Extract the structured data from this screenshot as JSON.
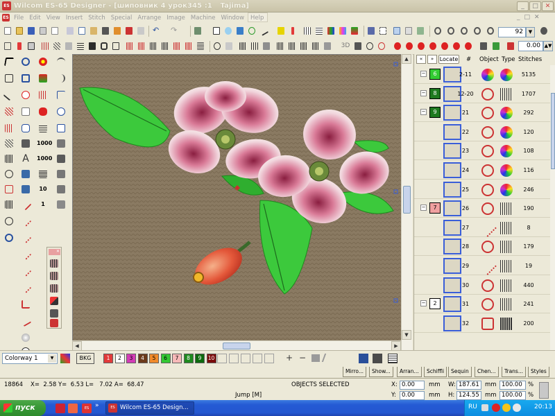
{
  "window": {
    "title": "Wilcom ES-65 Designer - [шиповник 4 урок345 :1",
    "machine": "Tajima]"
  },
  "menu": [
    "File",
    "Edit",
    "View",
    "Insert",
    "Stitch",
    "Special",
    "Arrange",
    "Image",
    "Machine",
    "Window",
    "Help"
  ],
  "toolbar": {
    "zoom_value": "92",
    "angle_value": "0.00"
  },
  "objects_panel": {
    "locate_label": "Locate",
    "columns": [
      "#",
      "Object",
      "Type",
      "Stitches"
    ],
    "rows": [
      {
        "group": "6",
        "group_color": "#33cc33",
        "num": "2-11",
        "stitches": "5135",
        "object_icon": "multicolor-icon",
        "type_icon": "multicolor-icon"
      },
      {
        "group": "8",
        "group_color": "#1f7a1f",
        "num": "12-20",
        "stitches": "1707",
        "object_icon": "complex-fill-icon",
        "type_icon": "satin-icon"
      },
      {
        "group": "9",
        "group_color": "#1f7a1f",
        "num": "21",
        "stitches": "292",
        "object_icon": "complex-fill-icon",
        "type_icon": "multicolor-icon"
      },
      {
        "group": "",
        "num": "22",
        "stitches": "120",
        "object_icon": "complex-fill-icon",
        "type_icon": "multicolor-icon"
      },
      {
        "group": "",
        "num": "23",
        "stitches": "108",
        "object_icon": "complex-fill-icon",
        "type_icon": "multicolor-icon"
      },
      {
        "group": "",
        "num": "24",
        "stitches": "116",
        "object_icon": "complex-fill-icon",
        "type_icon": "multicolor-icon"
      },
      {
        "group": "",
        "num": "25",
        "stitches": "246",
        "object_icon": "complex-fill-icon",
        "type_icon": "multicolor-icon"
      },
      {
        "group": "7",
        "group_color": "#f0a0a0",
        "num": "26",
        "stitches": "190",
        "object_icon": "complex-fill-icon",
        "type_icon": "satin-icon"
      },
      {
        "group": "",
        "num": "27",
        "stitches": "8",
        "object_icon": "run-icon",
        "type_icon": "satin-icon"
      },
      {
        "group": "",
        "num": "28",
        "stitches": "179",
        "object_icon": "complex-fill-icon",
        "type_icon": "satin-icon"
      },
      {
        "group": "",
        "num": "29",
        "stitches": "19",
        "object_icon": "run-icon",
        "type_icon": "satin-icon"
      },
      {
        "group": "",
        "num": "30",
        "stitches": "440",
        "object_icon": "complex-fill-icon",
        "type_icon": "satin-icon"
      },
      {
        "group": "2",
        "group_color": "#ffffff",
        "num": "31",
        "stitches": "241",
        "object_icon": "complex-fill-icon",
        "type_icon": "satin-icon"
      },
      {
        "group": "",
        "num": "32",
        "stitches": "200",
        "object_icon": "column-icon",
        "type_icon": "tatami-icon"
      }
    ]
  },
  "colorbar": {
    "colorway": "Colorway 1",
    "bkg_label": "BKG",
    "swatches": [
      {
        "label": "1",
        "color": "#e23a3a",
        "text": "#ffffff"
      },
      {
        "label": "2",
        "color": "#ffffff",
        "text": "#000000"
      },
      {
        "label": "3",
        "color": "#d33cb6",
        "text": "#000000"
      },
      {
        "label": "4",
        "color": "#6b3a1a",
        "text": "#ffffff"
      },
      {
        "label": "5",
        "color": "#f08a2a",
        "text": "#000000"
      },
      {
        "label": "6",
        "color": "#32c832",
        "text": "#000000"
      },
      {
        "label": "7",
        "color": "#f7b9b9",
        "text": "#000000"
      },
      {
        "label": "8",
        "color": "#1e8a1e",
        "text": "#ffffff"
      },
      {
        "label": "9",
        "color": "#0e6a0e",
        "text": "#ffffff"
      },
      {
        "label": "10",
        "color": "#7a0a0a",
        "text": "#ffffff"
      }
    ]
  },
  "tabs": [
    "Mirro...",
    "Show...",
    "Arran...",
    "Schiffli",
    "Sequin",
    "Chen...",
    "Trans...",
    "Styles"
  ],
  "status": {
    "stitch_count": "18864",
    "coords": "X=  2.58 Y=  6.53 L=   7.02 A=  68.47",
    "selection": "OBJECTS SELECTED",
    "stitch_type": "Jump [M]",
    "x_label": "X:",
    "x_value": "0.00",
    "y_label": "Y:",
    "y_value": "0.00",
    "w_label": "W:",
    "w_value": "187.61",
    "h_label": "H:",
    "h_value": "124.55",
    "unit": "mm",
    "pct_w": "100.00",
    "pct_h": "100.00",
    "pct_unit": "%"
  },
  "taskbar": {
    "start_label": "пуск",
    "task_label": "Wilcom ES-65 Design...",
    "lang": "RU",
    "clock": "20:13"
  },
  "colors": {
    "canvas_background": "#8a7a62",
    "selection_blue": "#3a5ed8",
    "taskbar_blue": "#245ad4"
  }
}
